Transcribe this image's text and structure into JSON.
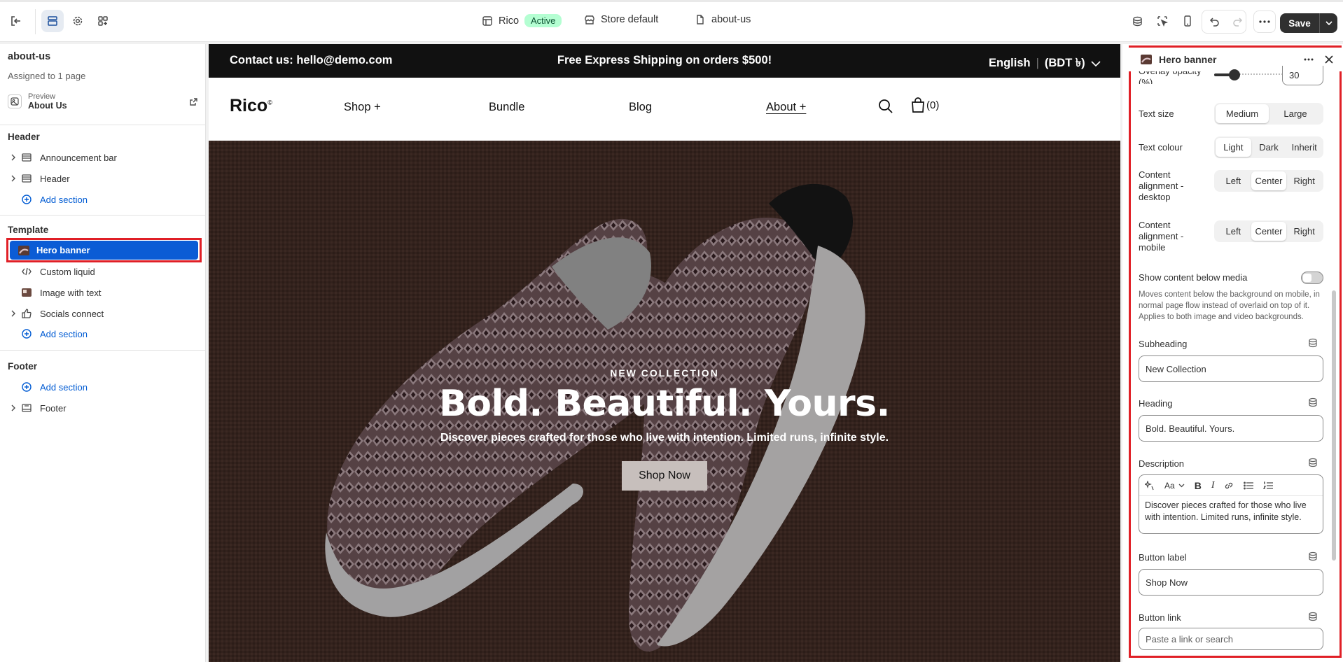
{
  "topbar": {
    "theme_name": "Rico",
    "theme_status": "Active",
    "store": "Store default",
    "page": "about-us",
    "save_label": "Save"
  },
  "left": {
    "page_title": "about-us",
    "assigned": "Assigned to 1 page",
    "preview_label": "Preview",
    "preview_page": "About Us",
    "header_group": "Header",
    "header_items": [
      "Announcement bar",
      "Header"
    ],
    "add_section": "Add section",
    "template_group": "Template",
    "template_items": [
      "Hero banner",
      "Custom liquid",
      "Image with text",
      "Socials connect"
    ],
    "footer_group": "Footer",
    "footer_items": [
      "Footer"
    ]
  },
  "store": {
    "announcement_left": "Contact us: hello@demo.com",
    "announcement_center": "Free Express Shipping on orders $500!",
    "language": "English",
    "currency": "(BDT ৳)",
    "logo": "Rico",
    "nav": [
      "Shop +",
      "Bundle",
      "Blog",
      "About +"
    ],
    "cart_count": "(0)",
    "hero_subheading": "NEW COLLECTION",
    "hero_heading": "Bold. Beautiful. Yours.",
    "hero_description": "Discover pieces crafted for those who live with intention. Limited runs, infinite style.",
    "hero_button": "Shop Now"
  },
  "panel": {
    "title": "Hero banner",
    "overlay_label": "Overlay opacity (%)",
    "overlay_value": "30",
    "overlay_fraction": 0.3,
    "text_size_label": "Text size",
    "text_size_options": [
      "Medium",
      "Large"
    ],
    "text_colour_label": "Text colour",
    "text_colour_options": [
      "Light",
      "Dark",
      "Inherit"
    ],
    "align_desktop_label": "Content alignment - desktop",
    "align_mobile_label": "Content alignment - mobile",
    "align_options": [
      "Left",
      "Center",
      "Right"
    ],
    "below_media_label": "Show content below media",
    "below_media_help": "Moves content below the background on mobile, in normal page flow instead of overlaid on top of it. Applies to both image and video backgrounds.",
    "subheading_label": "Subheading",
    "subheading_value": "New Collection",
    "heading_label": "Heading",
    "heading_value": "Bold. Beautiful. Yours.",
    "description_label": "Description",
    "description_value": "Discover pieces crafted for those who live with intention. Limited runs, infinite style.",
    "button_label_label": "Button label",
    "button_label_value": "Shop Now",
    "button_link_label": "Button link",
    "button_link_placeholder": "Paste a link or search"
  }
}
